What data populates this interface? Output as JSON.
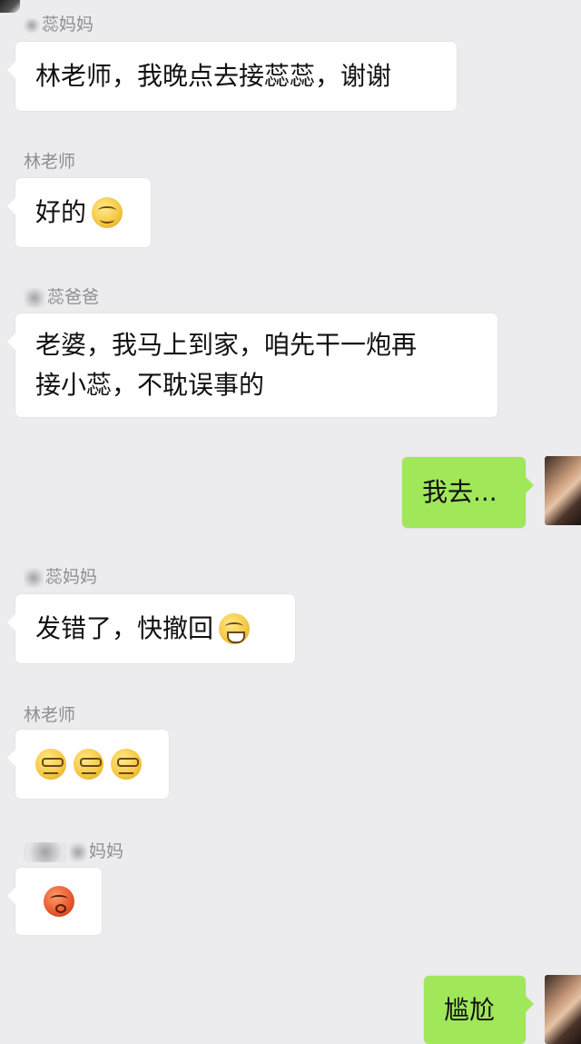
{
  "messages": [
    {
      "sender": "蕊妈妈",
      "text": "林老师，我晚点去接蕊蕊，谢谢"
    },
    {
      "sender": "林老师",
      "text": "好的"
    },
    {
      "sender": "蕊爸爸",
      "line1": "老婆，我马上到家，咱先干一炮再",
      "line2": "接小蕊，不耽误事的"
    },
    {
      "text": "我去..."
    },
    {
      "sender": "蕊妈妈",
      "text": "发错了，快撤回"
    },
    {
      "sender": "林老师"
    },
    {
      "sender": "妈妈"
    },
    {
      "text": "尴尬"
    }
  ],
  "icons": {
    "smile": "smile-emoji-icon",
    "cry": "crying-laugh-emoji-icon",
    "eyeroll": "eyeroll-emoji-icon",
    "angry": "angry-red-face-emoji-icon"
  }
}
